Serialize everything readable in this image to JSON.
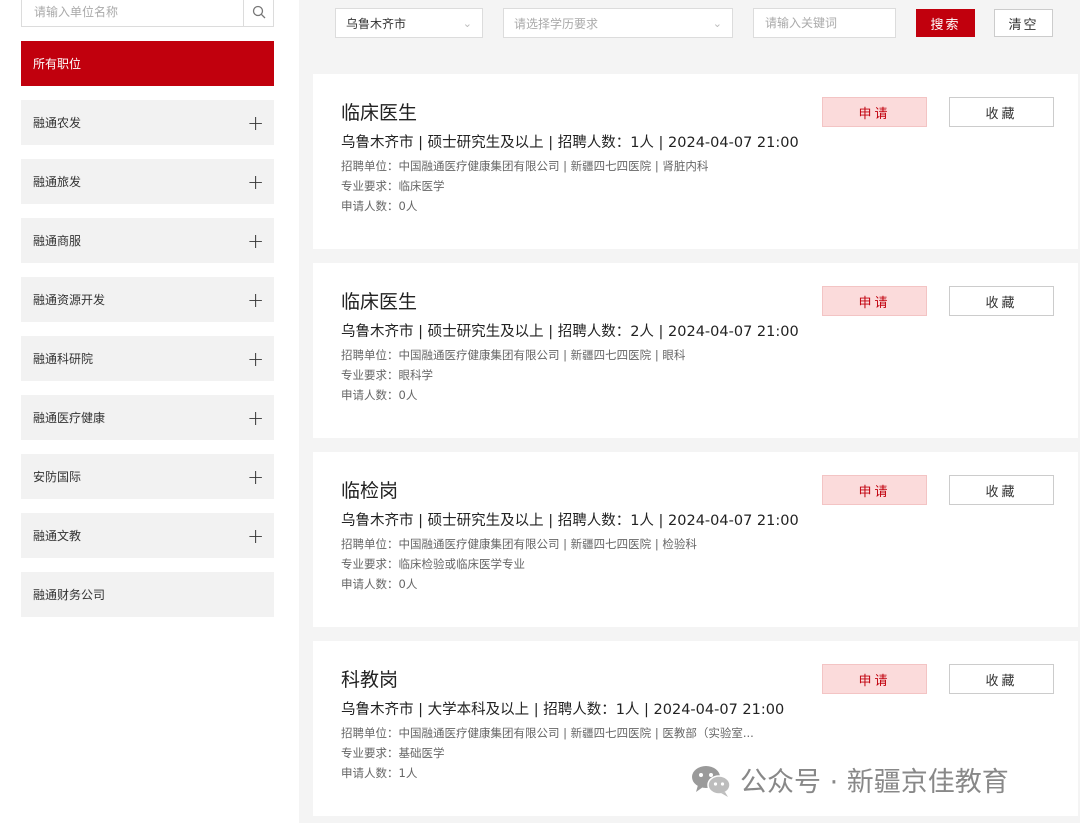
{
  "sidebar": {
    "search_placeholder": "请输入单位名称",
    "items": [
      {
        "label": "所有职位",
        "active": true,
        "expandable": false
      },
      {
        "label": "融通农发",
        "active": false,
        "expandable": true
      },
      {
        "label": "融通旅发",
        "active": false,
        "expandable": true
      },
      {
        "label": "融通商服",
        "active": false,
        "expandable": true
      },
      {
        "label": "融通资源开发",
        "active": false,
        "expandable": true
      },
      {
        "label": "融通科研院",
        "active": false,
        "expandable": true
      },
      {
        "label": "融通医疗健康",
        "active": false,
        "expandable": true
      },
      {
        "label": "安防国际",
        "active": false,
        "expandable": true
      },
      {
        "label": "融通文教",
        "active": false,
        "expandable": true
      },
      {
        "label": "融通财务公司",
        "active": false,
        "expandable": false
      }
    ],
    "expand_symbol": "+"
  },
  "filters": {
    "city_value": "乌鲁木齐市",
    "education_placeholder": "请选择学历要求",
    "keyword_placeholder": "请输入关键词",
    "search_label": "搜索",
    "clear_label": "清空"
  },
  "jobs": [
    {
      "title": "临床医生",
      "info": "乌鲁木齐市 | 硕士研究生及以上 | 招聘人数：1人 | 2024-04-07 21:00",
      "unit": "招聘单位：中国融通医疗健康集团有限公司 | 新疆四七四医院 | 肾脏内科",
      "major": "专业要求：临床医学",
      "applicants": "申请人数：0人",
      "apply_label": "申请",
      "fav_label": "收藏"
    },
    {
      "title": "临床医生",
      "info": "乌鲁木齐市 | 硕士研究生及以上 | 招聘人数：2人 | 2024-04-07 21:00",
      "unit": "招聘单位：中国融通医疗健康集团有限公司 | 新疆四七四医院 | 眼科",
      "major": "专业要求：眼科学",
      "applicants": "申请人数：0人",
      "apply_label": "申请",
      "fav_label": "收藏"
    },
    {
      "title": "临检岗",
      "info": "乌鲁木齐市 | 硕士研究生及以上 | 招聘人数：1人 | 2024-04-07 21:00",
      "unit": "招聘单位：中国融通医疗健康集团有限公司 | 新疆四七四医院 | 检验科",
      "major": "专业要求：临床检验或临床医学专业",
      "applicants": "申请人数：0人",
      "apply_label": "申请",
      "fav_label": "收藏"
    },
    {
      "title": "科教岗",
      "info": "乌鲁木齐市 | 大学本科及以上 | 招聘人数：1人 | 2024-04-07 21:00",
      "unit": "招聘单位：中国融通医疗健康集团有限公司 | 新疆四七四医院 | 医教部（实验室...",
      "major": "专业要求：基础医学",
      "applicants": "申请人数：1人",
      "apply_label": "申请",
      "fav_label": "收藏"
    }
  ],
  "watermark": {
    "text": "公众号 · 新疆京佳教育"
  },
  "colors": {
    "accent": "#c1000d",
    "apply_bg": "#fbdbdb",
    "page_bg": "#f4f4f4"
  }
}
